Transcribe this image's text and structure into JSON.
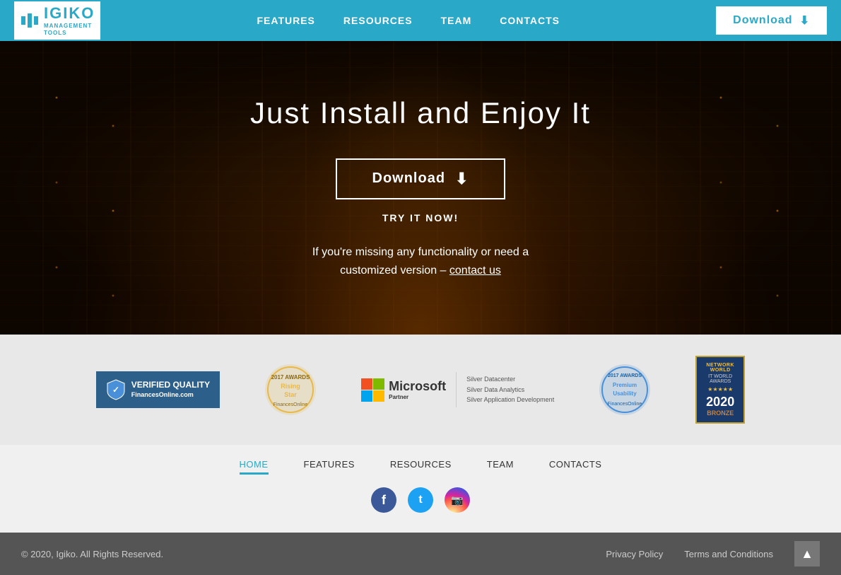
{
  "header": {
    "logo_text": "IGIKO",
    "logo_sub": "MANAGEMENT\nTOOLS",
    "nav": {
      "items": [
        {
          "label": "FEATURES",
          "id": "features"
        },
        {
          "label": "RESOURCES",
          "id": "resources"
        },
        {
          "label": "TEAM",
          "id": "team"
        },
        {
          "label": "CONTACTS",
          "id": "contacts"
        }
      ]
    },
    "download_btn": "Download"
  },
  "hero": {
    "title": "Just Install and Enjoy It",
    "download_btn": "Download",
    "try_it_now": "TRY IT NOW!",
    "missing_text": "If you're missing any functionality or need a",
    "missing_text2": "customized version –",
    "contact_link": "contact us"
  },
  "badges": {
    "verified": {
      "title": "VERIFIED QUALITY",
      "sub": "FinancesOnline.com"
    },
    "rising_star": "Rising Star",
    "ms_partner_title": "Microsoft",
    "ms_partner_lines": [
      "Silver Datacenter",
      "Silver Data Analytics",
      "Silver Application Development"
    ],
    "premium": "Premium Usability",
    "it_world_title": "IT WORLD AWARDS",
    "it_world_year": "2020",
    "it_world_bronze": "BRONZE"
  },
  "footer": {
    "nav_items": [
      {
        "label": "HOME",
        "active": true
      },
      {
        "label": "FEATURES",
        "active": false
      },
      {
        "label": "RESOURCES",
        "active": false
      },
      {
        "label": "TEAM",
        "active": false
      },
      {
        "label": "CONTACTS",
        "active": false
      }
    ],
    "social": [
      {
        "icon": "f",
        "type": "facebook"
      },
      {
        "icon": "t",
        "type": "twitter"
      },
      {
        "icon": "📷",
        "type": "instagram"
      }
    ],
    "copyright": "© 2020, Igiko. All Rights Reserved.",
    "privacy": "Privacy Policy",
    "terms": "Terms and Conditions"
  }
}
